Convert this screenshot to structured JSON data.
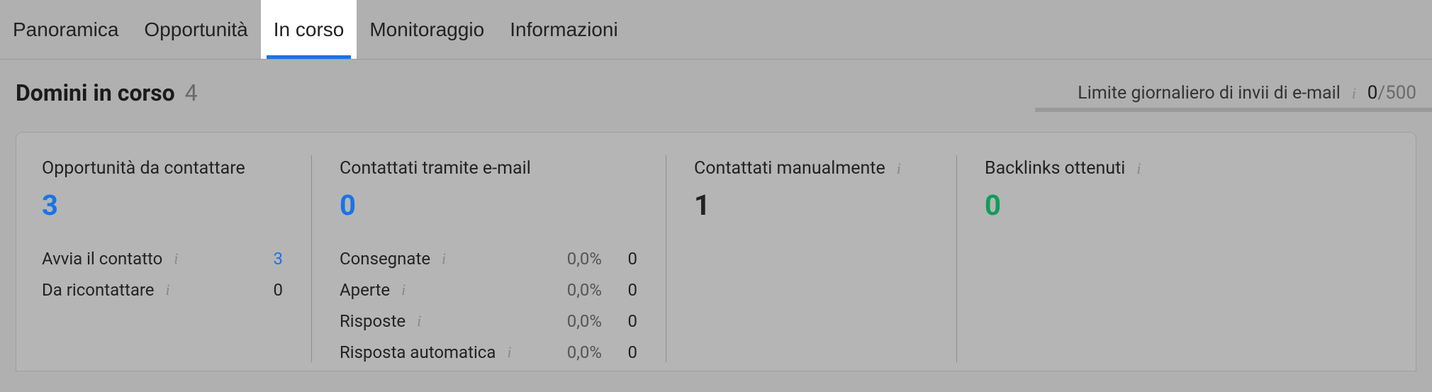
{
  "tabs": [
    {
      "label": "Panoramica",
      "active": false
    },
    {
      "label": "Opportunità",
      "active": false
    },
    {
      "label": "In corso",
      "active": true
    },
    {
      "label": "Monitoraggio",
      "active": false
    },
    {
      "label": "Informazioni",
      "active": false
    }
  ],
  "page": {
    "title": "Domini in corso",
    "count": "4"
  },
  "dailyLimit": {
    "label": "Limite giornaliero di invii di e-mail",
    "used": "0",
    "max": "/500"
  },
  "metrics": {
    "prospects": {
      "title": "Opportunità da contattare",
      "value": "3",
      "rows": [
        {
          "label": "Avvia il contatto",
          "count": "3"
        },
        {
          "label": "Da ricontattare",
          "count": "0"
        }
      ]
    },
    "emailed": {
      "title": "Contattati tramite e-mail",
      "value": "0",
      "rows": [
        {
          "label": "Consegnate",
          "pct": "0,0%",
          "count": "0"
        },
        {
          "label": "Aperte",
          "pct": "0,0%",
          "count": "0"
        },
        {
          "label": "Risposte",
          "pct": "0,0%",
          "count": "0"
        },
        {
          "label": "Risposta automatica",
          "pct": "0,0%",
          "count": "0"
        }
      ]
    },
    "manual": {
      "title": "Contattati manualmente",
      "value": "1"
    },
    "backlinks": {
      "title": "Backlinks ottenuti",
      "value": "0"
    }
  }
}
